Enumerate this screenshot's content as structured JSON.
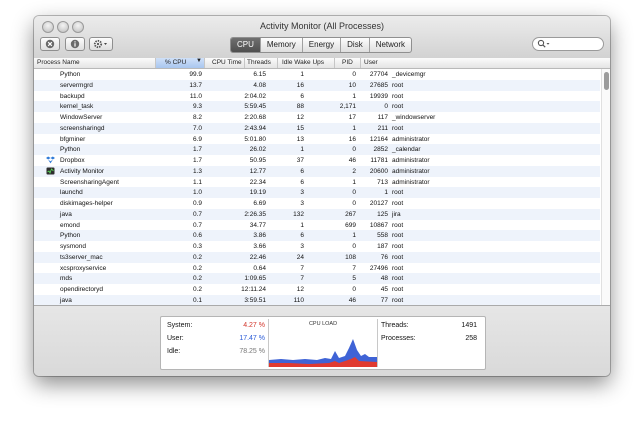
{
  "window": {
    "title": "Activity Monitor (All Processes)"
  },
  "toolbar": {
    "tabs": [
      {
        "label": "CPU",
        "active": true
      },
      {
        "label": "Memory",
        "active": false
      },
      {
        "label": "Energy",
        "active": false
      },
      {
        "label": "Disk",
        "active": false
      },
      {
        "label": "Network",
        "active": false
      }
    ]
  },
  "columns": {
    "name": "Process Name",
    "cpu": "% CPU",
    "time": "CPU Time",
    "threads": "Threads",
    "idle": "Idle Wake Ups",
    "pid": "PID",
    "user": "User"
  },
  "processes": [
    {
      "name": "Python",
      "cpu": "99.9",
      "time": "6.15",
      "threads": "1",
      "idle": "0",
      "pid": "27704",
      "user": "_devicemgr",
      "icon": ""
    },
    {
      "name": "servermgrd",
      "cpu": "13.7",
      "time": "4.08",
      "threads": "16",
      "idle": "10",
      "pid": "27685",
      "user": "root",
      "icon": ""
    },
    {
      "name": "backupd",
      "cpu": "11.0",
      "time": "2:04.02",
      "threads": "6",
      "idle": "1",
      "pid": "19939",
      "user": "root",
      "icon": ""
    },
    {
      "name": "kernel_task",
      "cpu": "9.3",
      "time": "5:59.45",
      "threads": "88",
      "idle": "2,171",
      "pid": "0",
      "user": "root",
      "icon": ""
    },
    {
      "name": "WindowServer",
      "cpu": "8.2",
      "time": "2:20.68",
      "threads": "12",
      "idle": "17",
      "pid": "117",
      "user": "_windowserver",
      "icon": ""
    },
    {
      "name": "screensharingd",
      "cpu": "7.0",
      "time": "2:43.94",
      "threads": "15",
      "idle": "1",
      "pid": "211",
      "user": "root",
      "icon": ""
    },
    {
      "name": "bfgminer",
      "cpu": "6.9",
      "time": "5:01.80",
      "threads": "13",
      "idle": "16",
      "pid": "12164",
      "user": "administrator",
      "icon": ""
    },
    {
      "name": "Python",
      "cpu": "1.7",
      "time": "26.02",
      "threads": "1",
      "idle": "0",
      "pid": "2852",
      "user": "_calendar",
      "icon": ""
    },
    {
      "name": "Dropbox",
      "cpu": "1.7",
      "time": "50.95",
      "threads": "37",
      "idle": "46",
      "pid": "11781",
      "user": "administrator",
      "icon": "dropbox-icon"
    },
    {
      "name": "Activity Monitor",
      "cpu": "1.3",
      "time": "12.77",
      "threads": "6",
      "idle": "2",
      "pid": "20600",
      "user": "administrator",
      "icon": "activity-monitor-icon"
    },
    {
      "name": "ScreensharingAgent",
      "cpu": "1.1",
      "time": "22.34",
      "threads": "6",
      "idle": "1",
      "pid": "713",
      "user": "administrator",
      "icon": ""
    },
    {
      "name": "launchd",
      "cpu": "1.0",
      "time": "19.19",
      "threads": "3",
      "idle": "0",
      "pid": "1",
      "user": "root",
      "icon": ""
    },
    {
      "name": "diskimages-helper",
      "cpu": "0.9",
      "time": "6.69",
      "threads": "3",
      "idle": "0",
      "pid": "20127",
      "user": "root",
      "icon": ""
    },
    {
      "name": "java",
      "cpu": "0.7",
      "time": "2:26.35",
      "threads": "132",
      "idle": "267",
      "pid": "125",
      "user": "jira",
      "icon": ""
    },
    {
      "name": "emond",
      "cpu": "0.7",
      "time": "34.77",
      "threads": "1",
      "idle": "699",
      "pid": "10867",
      "user": "root",
      "icon": ""
    },
    {
      "name": "Python",
      "cpu": "0.6",
      "time": "3.86",
      "threads": "6",
      "idle": "1",
      "pid": "558",
      "user": "root",
      "icon": ""
    },
    {
      "name": "sysmond",
      "cpu": "0.3",
      "time": "3.66",
      "threads": "3",
      "idle": "0",
      "pid": "187",
      "user": "root",
      "icon": ""
    },
    {
      "name": "ts3server_mac",
      "cpu": "0.2",
      "time": "22.46",
      "threads": "24",
      "idle": "108",
      "pid": "76",
      "user": "root",
      "icon": ""
    },
    {
      "name": "xcsproxyservice",
      "cpu": "0.2",
      "time": "0.64",
      "threads": "7",
      "idle": "7",
      "pid": "27496",
      "user": "root",
      "icon": ""
    },
    {
      "name": "mds",
      "cpu": "0.2",
      "time": "1:09.65",
      "threads": "7",
      "idle": "5",
      "pid": "48",
      "user": "root",
      "icon": ""
    },
    {
      "name": "opendirectoryd",
      "cpu": "0.2",
      "time": "12:11.24",
      "threads": "12",
      "idle": "0",
      "pid": "45",
      "user": "root",
      "icon": ""
    },
    {
      "name": "java",
      "cpu": "0.1",
      "time": "3:59.51",
      "threads": "110",
      "idle": "46",
      "pid": "77",
      "user": "root",
      "icon": ""
    }
  ],
  "stats": {
    "system_label": "System:",
    "system_value": "4.27 %",
    "system_color": "#d2352b",
    "user_label": "User:",
    "user_value": "17.47 %",
    "user_color": "#2a5bd7",
    "idle_label": "Idle:",
    "idle_value": "78.25 %",
    "idle_color": "#777777",
    "graph_title": "CPU LOAD",
    "threads_label": "Threads:",
    "threads_value": "1491",
    "processes_label": "Processes:",
    "processes_value": "258"
  }
}
